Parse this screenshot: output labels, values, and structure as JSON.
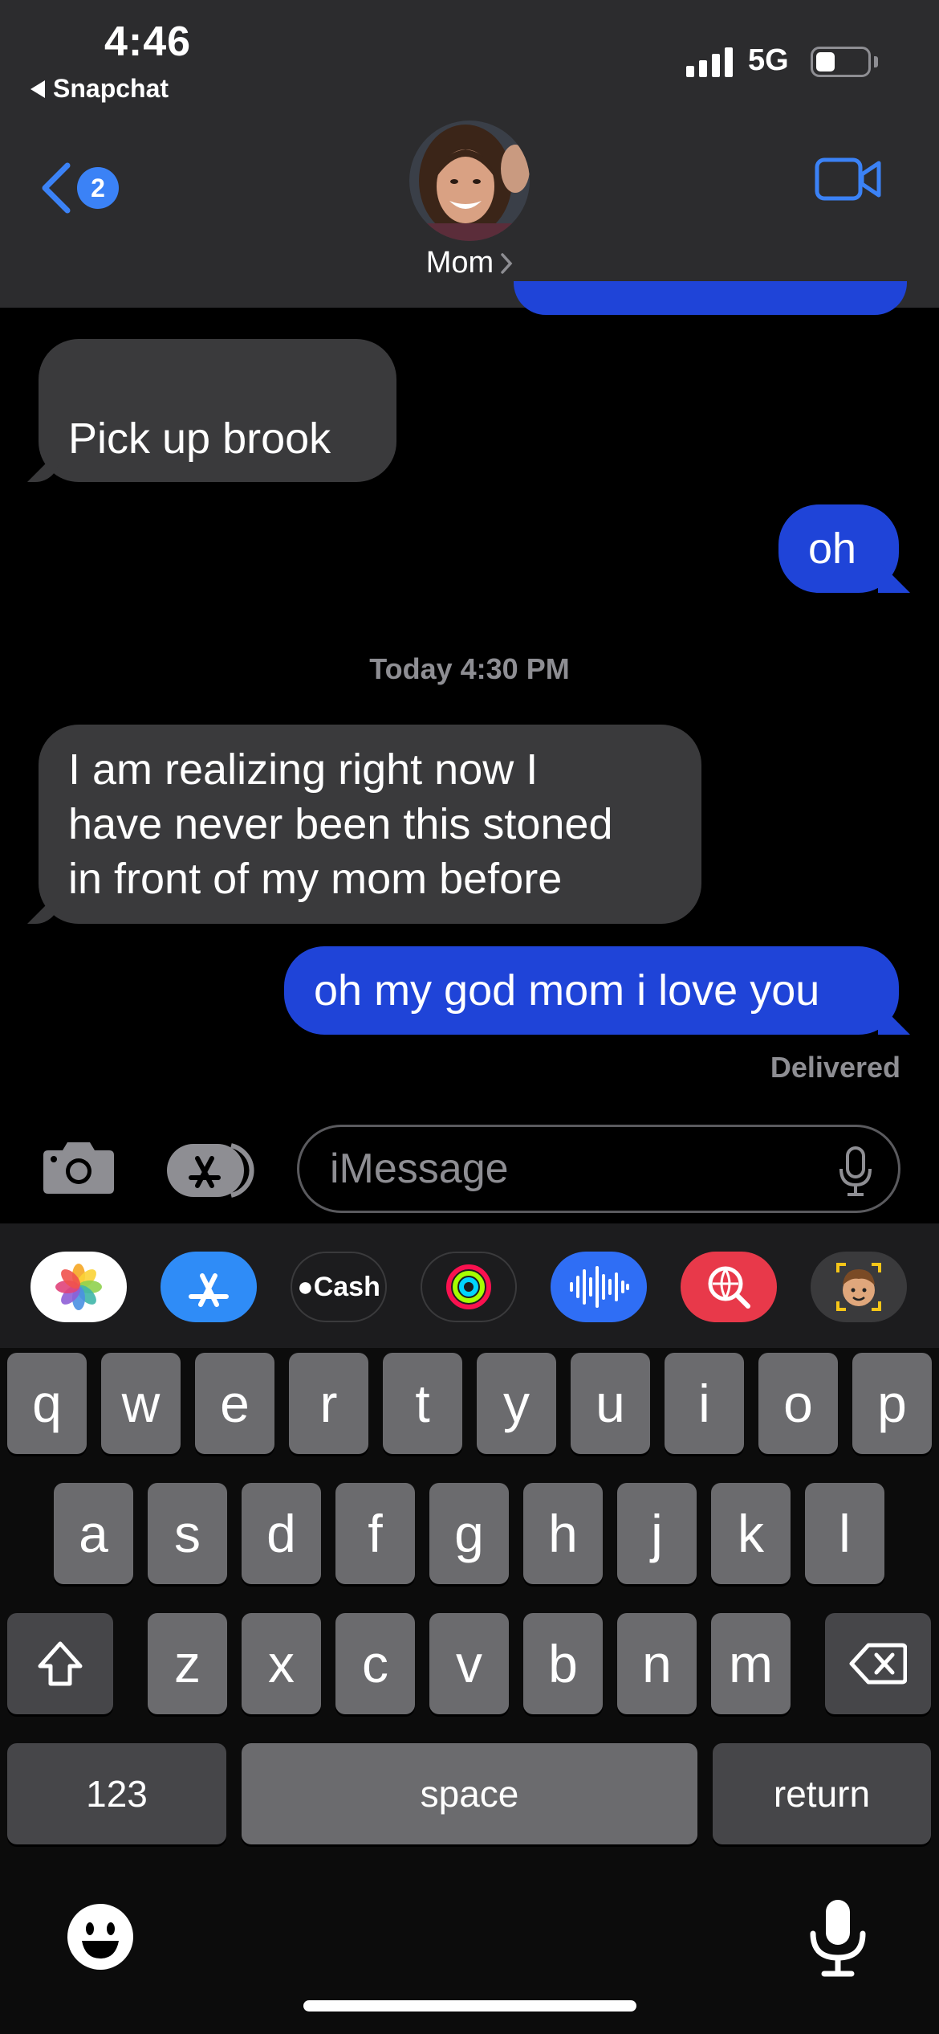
{
  "status_bar": {
    "time": "4:46",
    "back_app": "Snapchat",
    "network": "5G",
    "battery_level": 0.38
  },
  "header": {
    "back_badge": "2",
    "contact_name": "Mom"
  },
  "messages": {
    "m1": "Pick up brook",
    "m2": "oh",
    "timestamp": "Today 4:30 PM",
    "m3_line1": "I am realizing right now I",
    "m3_line2": "have never been this stoned",
    "m3_line3": "in front of my mom before",
    "m4": "oh my god mom i love you",
    "status": "Delivered"
  },
  "input": {
    "placeholder": "iMessage"
  },
  "app_strip": {
    "apps": [
      "photos-app",
      "app-store",
      "apple-cash",
      "activity",
      "audio-message",
      "web-search",
      "memoji"
    ],
    "cash_label": "Cash"
  },
  "keyboard": {
    "row1": [
      "q",
      "w",
      "e",
      "r",
      "t",
      "y",
      "u",
      "i",
      "o",
      "p"
    ],
    "row2": [
      "a",
      "s",
      "d",
      "f",
      "g",
      "h",
      "j",
      "k",
      "l"
    ],
    "row3": [
      "z",
      "x",
      "c",
      "v",
      "b",
      "n",
      "m"
    ],
    "numbers_key": "123",
    "space_key": "space",
    "return_key": "return"
  },
  "colors": {
    "accent": "#3b82f6",
    "outgoing_bubble": "#1f44d8",
    "incoming_bubble": "#3a3a3c",
    "header_bg": "#2c2c2e"
  }
}
